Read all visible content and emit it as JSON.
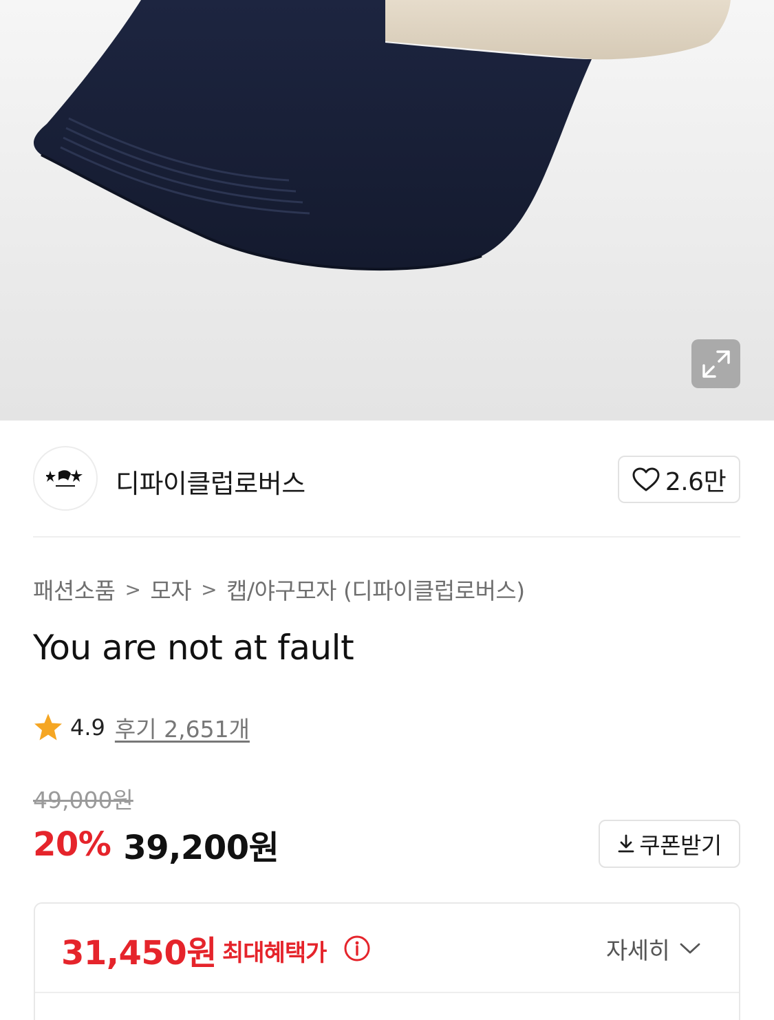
{
  "seller": {
    "name": "디파이클럽로버스",
    "like_count": "2.6만"
  },
  "breadcrumb": [
    "패션소품",
    "모자",
    "캡/야구모자 (디파이클럽로버스)"
  ],
  "product": {
    "title": "You are not at fault",
    "rating": "4.9",
    "review_text": "후기 2,651개"
  },
  "price": {
    "original": "49,000원",
    "discount": "20%",
    "sale": "39,200원",
    "coupon_label": "쿠폰받기"
  },
  "benefit": {
    "price": "31,450원",
    "label": "최대혜택가",
    "detail_label": "자세히"
  },
  "colors": {
    "accent_red": "#e5242b",
    "star": "#f5a623",
    "cap_navy": "#182038",
    "cap_beige": "#ddd3c2"
  },
  "icons": {
    "expand": "expand-icon",
    "like": "heart-icon",
    "rating": "star-icon",
    "coupon": "download-icon",
    "info": "info-icon",
    "detail": "chevron-down-icon"
  }
}
